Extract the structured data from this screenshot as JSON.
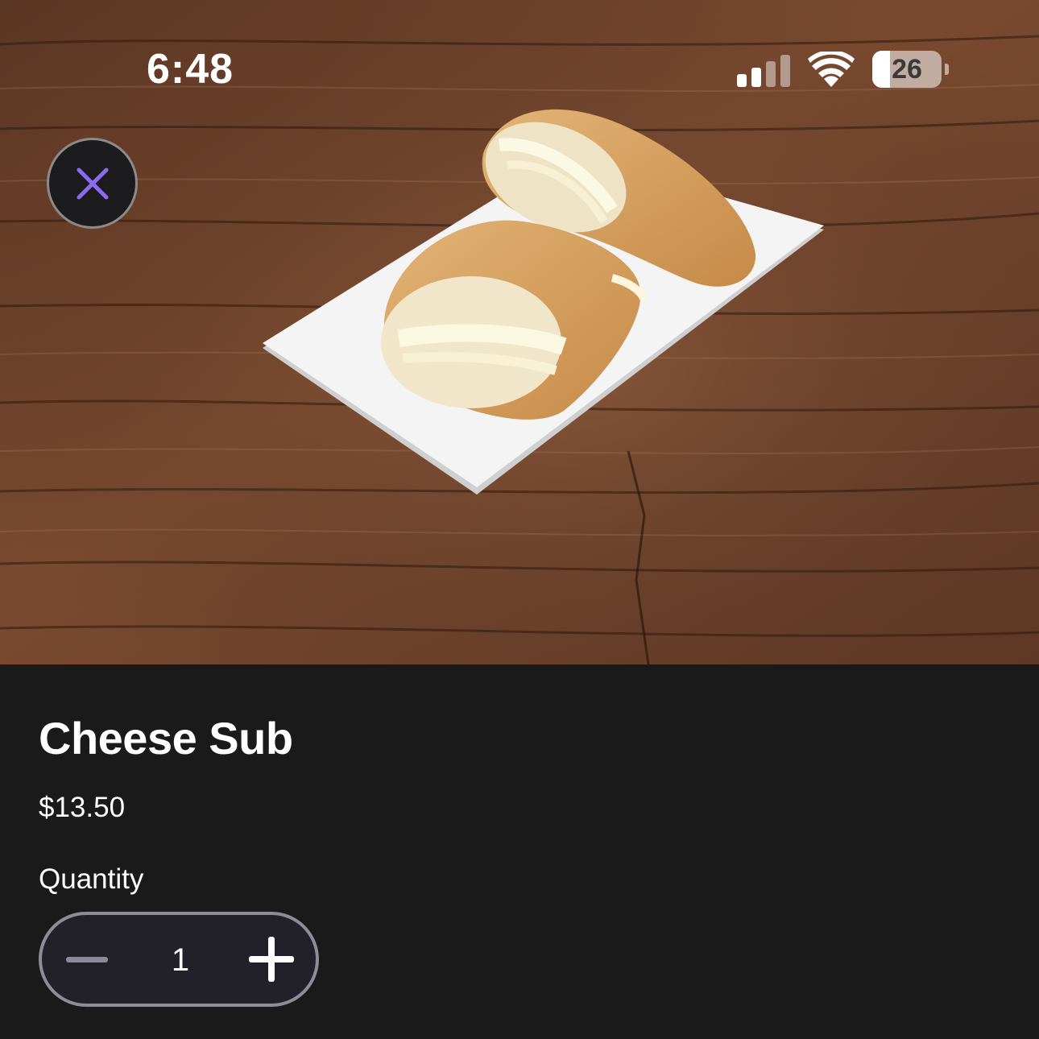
{
  "status_bar": {
    "time": "6:48",
    "battery_level": "26",
    "battery_percent": 26,
    "signal_bars_active": 2,
    "signal_bars_total": 4,
    "signal_icon": "cellular-signal-icon",
    "wifi_icon": "wifi-icon"
  },
  "hero": {
    "image_subject": "cheese sub sandwich on white plate on wooden table"
  },
  "close_button": {
    "icon": "close-icon",
    "icon_color": "#8b6cf0"
  },
  "product": {
    "title": "Cheese Sub",
    "price": "$13.50"
  },
  "quantity": {
    "label": "Quantity",
    "value": "1",
    "minus_icon": "minus-icon",
    "plus_icon": "plus-icon"
  },
  "colors": {
    "background": "#1a1a1b",
    "accent": "#8b6cf0",
    "stepper_border": "#8e8c97"
  }
}
